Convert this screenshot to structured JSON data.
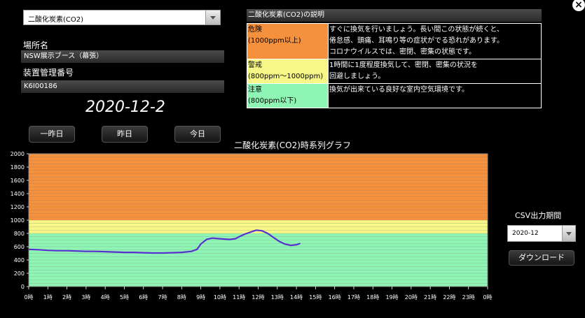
{
  "sensor_select": {
    "value": "二酸化炭素(CO2)"
  },
  "location": {
    "label": "場所名",
    "value": "NSW展示ブース（幕張）"
  },
  "device": {
    "label": "装置管理番号",
    "value": "K6I00186"
  },
  "date": "2020-12-2",
  "nav": {
    "prev2": "一昨日",
    "prev": "昨日",
    "today": "今日"
  },
  "legend": {
    "header": "二酸化炭素(CO2)の説明",
    "rows": [
      {
        "level": "危険",
        "range": "(1000ppm以上)",
        "color": "#f5903c",
        "desc": [
          "すぐに換気を行いましょう。長い間この状態が続くと、",
          "倦怠感、頭痛、耳鳴り等の症状がでる恐れがあります。",
          "コロナウイルスでは、密閉、密集の状態です。"
        ]
      },
      {
        "level": "警戒",
        "range": "(800ppm～1000ppm)",
        "color": "#f7f787",
        "desc": [
          "1時間に1度程度換気して、密閉、密集の状況を",
          "回避しましょう。"
        ]
      },
      {
        "level": "注意",
        "range": "(800ppm以下)",
        "color": "#8ff5b5",
        "desc": [
          "換気が出来ている良好な室内空気環境です。"
        ]
      }
    ]
  },
  "csv": {
    "label": "CSV出力期間",
    "value": "2020-12",
    "download": "ダウンロード"
  },
  "close_label": "×",
  "chart_data": {
    "type": "line",
    "title": "二酸化炭素(CO2)時系列グラフ",
    "ylim": [
      0,
      2000
    ],
    "yticks": [
      0,
      200,
      400,
      600,
      800,
      1000,
      1200,
      1400,
      1600,
      1800,
      2000
    ],
    "xlim": [
      0,
      24
    ],
    "xticks": [
      "0時",
      "1時",
      "2時",
      "3時",
      "4時",
      "5時",
      "6時",
      "7時",
      "8時",
      "9時",
      "10時",
      "11時",
      "12時",
      "13時",
      "14時",
      "15時",
      "16時",
      "17時",
      "18時",
      "19時",
      "20時",
      "21時",
      "22時",
      "23時",
      "0時"
    ],
    "bands": [
      {
        "from": 0,
        "to": 800,
        "color": "#8ff5b5"
      },
      {
        "from": 800,
        "to": 1000,
        "color": "#f7f787"
      },
      {
        "from": 1000,
        "to": 2000,
        "color": "#f5903c"
      }
    ],
    "series": [
      {
        "color": "#5a2fd0",
        "x": [
          0,
          0.5,
          1,
          1.5,
          2,
          2.5,
          3,
          3.5,
          4,
          4.5,
          5,
          5.5,
          6,
          6.5,
          7,
          7.5,
          8,
          8.5,
          8.8,
          9.0,
          9.3,
          9.6,
          10,
          10.5,
          10.8,
          11.0,
          11.3,
          11.6,
          11.9,
          12.2,
          12.5,
          12.8,
          13.1,
          13.4,
          13.7,
          14.0,
          14.2
        ],
        "y": [
          560,
          555,
          545,
          540,
          540,
          535,
          530,
          530,
          525,
          520,
          515,
          515,
          510,
          505,
          505,
          510,
          515,
          530,
          560,
          640,
          710,
          730,
          720,
          710,
          720,
          750,
          790,
          820,
          850,
          840,
          800,
          740,
          680,
          640,
          620,
          630,
          650
        ]
      }
    ]
  }
}
